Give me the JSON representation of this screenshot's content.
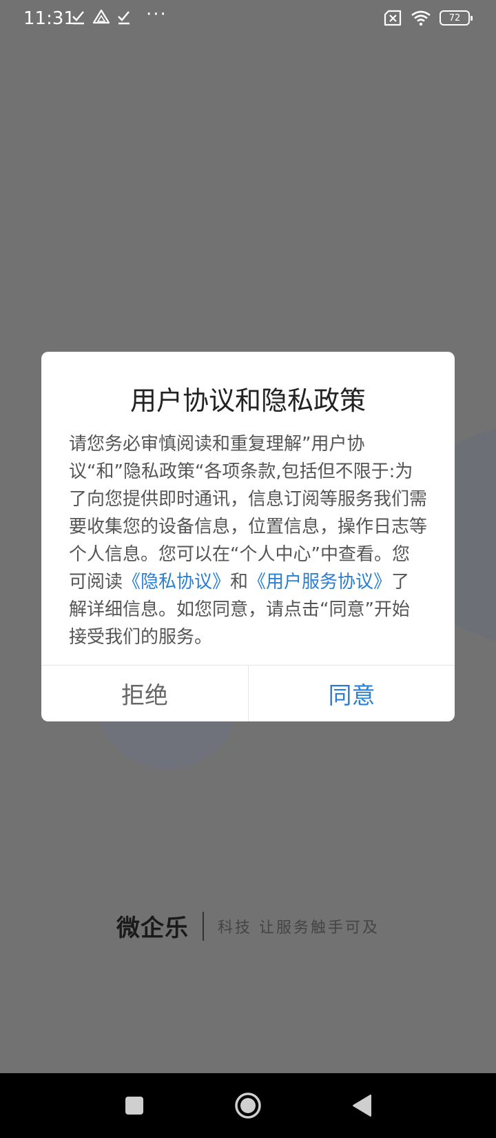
{
  "status_bar": {
    "time": "11:31",
    "more": "···",
    "battery": "72"
  },
  "dialog": {
    "title": "用户协议和隐私政策",
    "body_part1": "请您务必审慎阅读和重复理解”用户协议“和”隐私政策“各项条款,包括但不限于:为了向您提供即时通讯，信息订阅等服务我们需要收集您的设备信息，位置信息，操作日志等个人信息。您可以在“个人中心”中查看。您可阅读",
    "privacy_link": "《隐私协议》",
    "connector": "和",
    "service_link": "《用户服务协议》",
    "body_part2": "了解详细信息。如您同意，请点击“同意”开始接受我们的服务。",
    "reject_label": "拒绝",
    "agree_label": "同意"
  },
  "brand": {
    "logo": "微企乐",
    "slogan": "科技 让服务触手可及"
  },
  "colors": {
    "link": "#2a7fd4",
    "overlay": "#727272"
  }
}
